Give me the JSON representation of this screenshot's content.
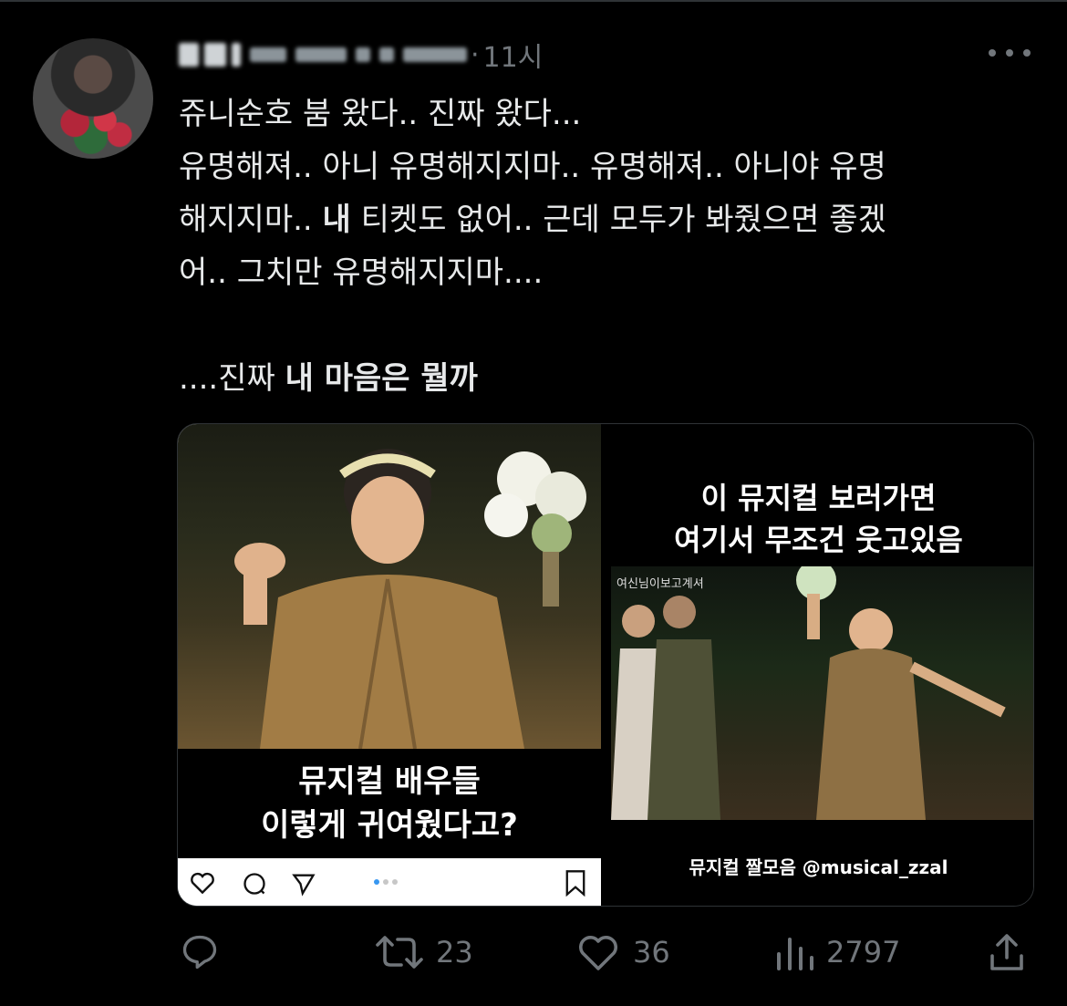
{
  "header": {
    "time": "11시",
    "separator": "·"
  },
  "body": {
    "line1": "쥬니순호 붐 왔다.. 진짜 왔다...",
    "line2": "유명해져.. 아니 유명해지지마.. 유명해져.. 아니야 유명",
    "line3_a": "해지지마.. ",
    "line3_bold": "내",
    "line3_b": " 티켓도 없어.. 근데 모두가 봐줬으면 좋겠",
    "line4": "어.. 그치만 유명해지지마....",
    "line5_a": "....진짜 ",
    "line5_bold": "내 마음은 뭘까"
  },
  "media": {
    "left_caption_1": "뮤지컬 배우들",
    "left_caption_2": "이렇게 귀여웠다고?",
    "right_title_1": "이 뮤지컬 보러가면",
    "right_title_2": "여기서 무조건 웃고있음",
    "right_photo_label": "여신님이보고계셔",
    "right_credit": "뮤지컬 짤모음 @musical_zzal"
  },
  "actions": {
    "retweets": "23",
    "likes": "36",
    "views": "2797"
  }
}
